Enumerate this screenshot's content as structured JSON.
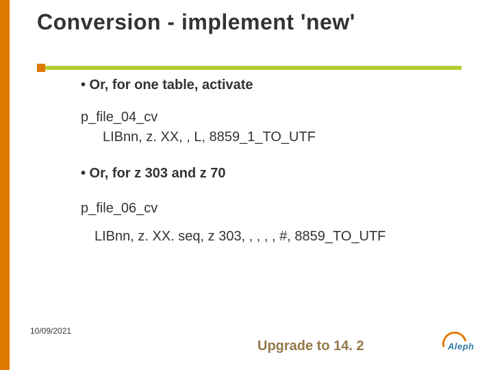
{
  "title": "Conversion - implement 'new'",
  "bullets": {
    "b1": "• Or, for one table, activate",
    "l1": "p_file_04_cv",
    "l2": "LIBnn, z. XX, , L, 8859_1_TO_UTF",
    "b2": "• Or, for z 303 and z 70",
    "l3": "p_file_06_cv",
    "l4": "LIBnn, z. XX. seq, z 303, , , , , #, 8859_TO_UTF"
  },
  "date": "10/09/2021",
  "footer": "Upgrade to 14. 2",
  "logo": "Aleph"
}
